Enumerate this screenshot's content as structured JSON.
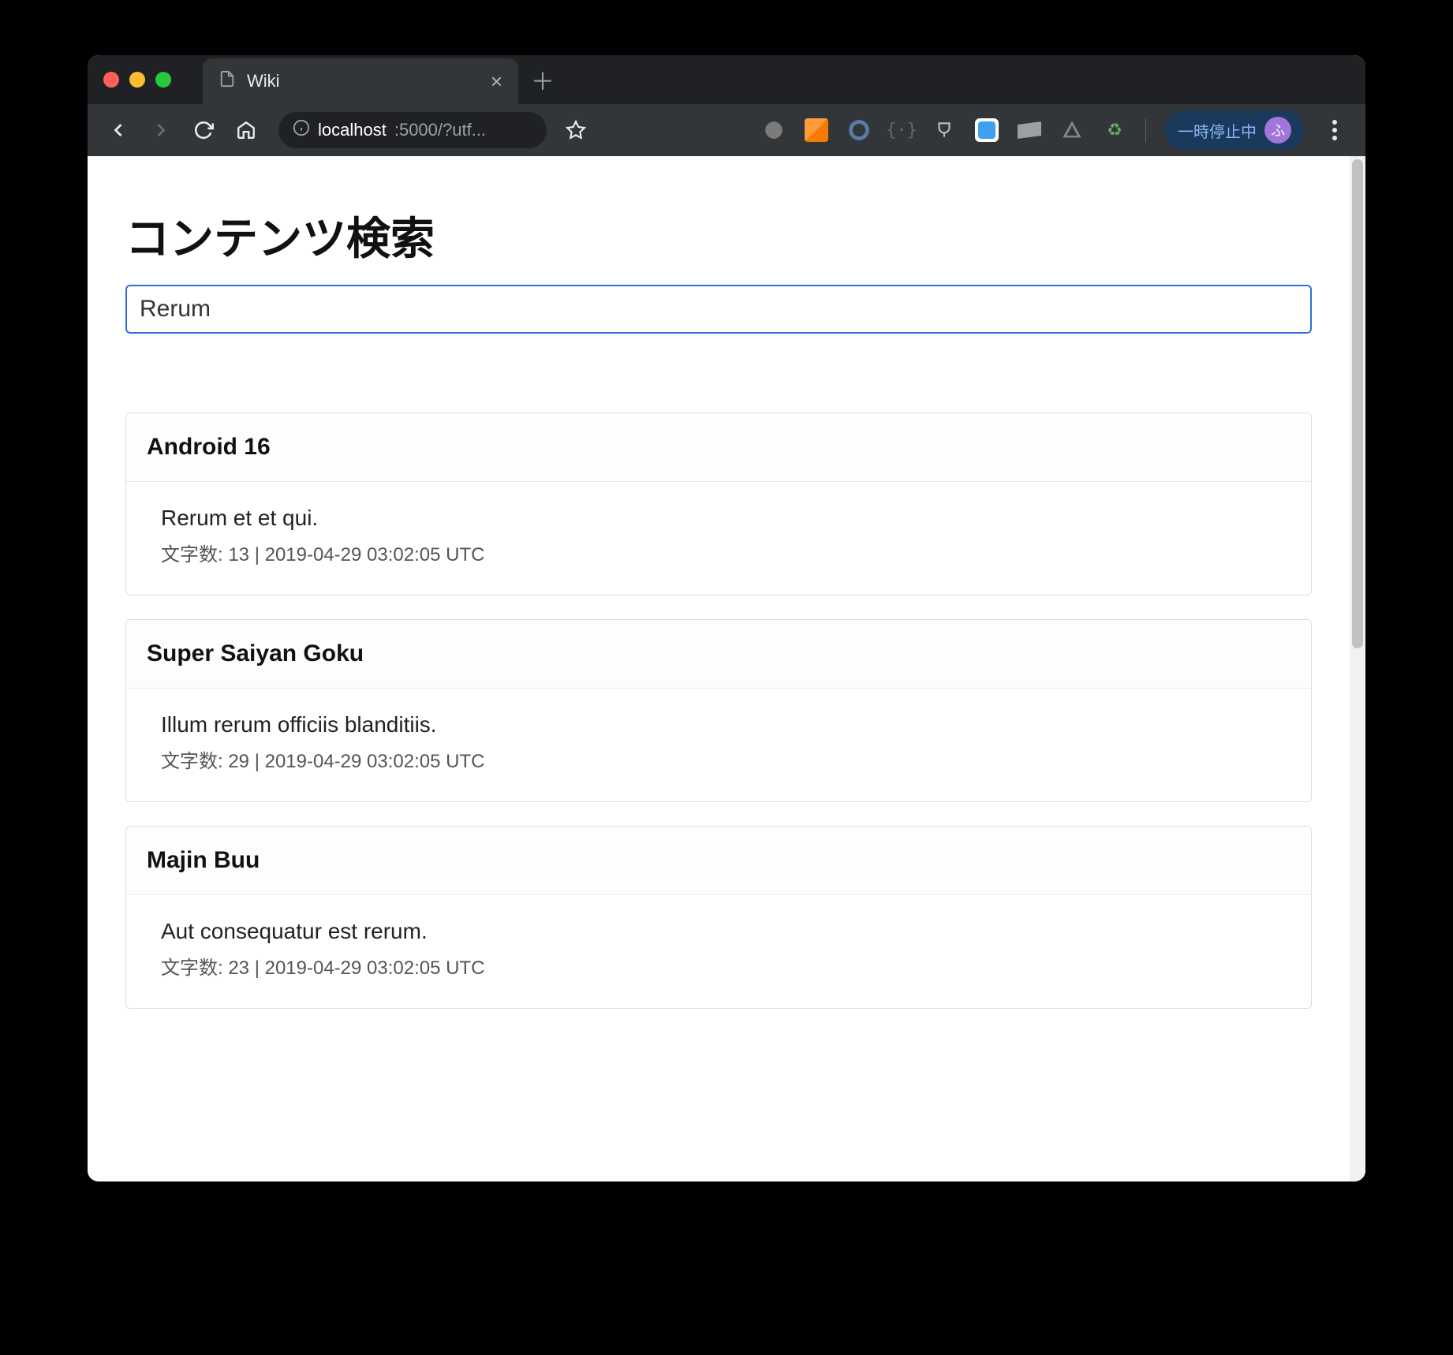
{
  "browser": {
    "tab_title": "Wiki",
    "address": {
      "host": "localhost",
      "path": ":5000/?utf..."
    },
    "paused_label": "一時停止中",
    "avatar_letter": "ふ"
  },
  "page": {
    "title": "コンテンツ検索",
    "search_value": "Rerum",
    "meta_prefix": "文字数: ",
    "meta_separator": " | ",
    "results": [
      {
        "title": "Android 16",
        "snippet": "Rerum et et qui.",
        "char_count": "13",
        "timestamp": "2019-04-29 03:02:05 UTC"
      },
      {
        "title": "Super Saiyan Goku",
        "snippet": "Illum rerum officiis blanditiis.",
        "char_count": "29",
        "timestamp": "2019-04-29 03:02:05 UTC"
      },
      {
        "title": "Majin Buu",
        "snippet": "Aut consequatur est rerum.",
        "char_count": "23",
        "timestamp": "2019-04-29 03:02:05 UTC"
      }
    ]
  }
}
